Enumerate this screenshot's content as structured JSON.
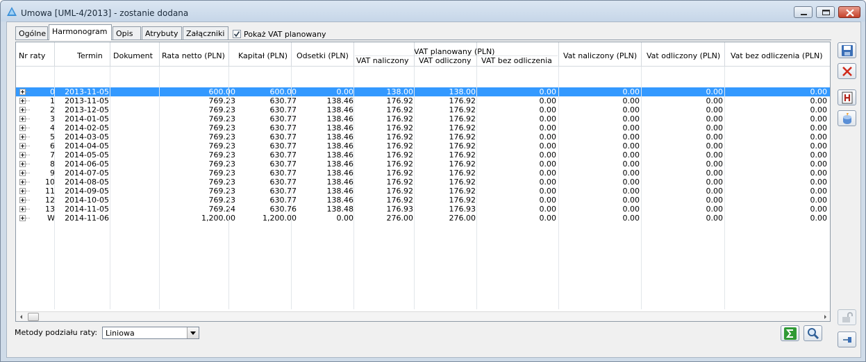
{
  "window": {
    "title": "Umowa [UML-4/2013] - zostanie dodana"
  },
  "tabs": [
    {
      "label": "Ogólne"
    },
    {
      "label": "Harmonogram",
      "active": true
    },
    {
      "label": "Opis"
    },
    {
      "label": "Atrybuty"
    },
    {
      "label": "Załączniki"
    }
  ],
  "show_vat_checkbox": {
    "label": "Pokaż VAT planowany",
    "checked": true
  },
  "table": {
    "headers": {
      "nr_raty": "Nr raty",
      "termin": "Termin",
      "dokument": "Dokument",
      "rata_netto": "Rata netto (PLN)",
      "kapital": "Kapitał (PLN)",
      "odsetki": "Odsetki (PLN)",
      "vat_planowany_group": "VAT planowany (PLN)",
      "vat_plan_naliczony": "VAT naliczony",
      "vat_plan_odliczony": "VAT odliczony",
      "vat_plan_bez": "VAT bez odliczenia",
      "vat_naliczony": "Vat naliczony (PLN)",
      "vat_odliczony": "Vat odliczony (PLN)",
      "vat_bez": "Vat bez odliczenia (PLN)"
    },
    "rows": [
      {
        "nr": "0",
        "termin": "2013-11-05",
        "dokument": "",
        "rata": "600.00",
        "kapital": "600.00",
        "odsetki": "0.00",
        "pn": "138.00",
        "po": "138.00",
        "pb": "0.00",
        "vn": "0.00",
        "vo": "0.00",
        "vb": "0.00"
      },
      {
        "nr": "1",
        "termin": "2013-11-05",
        "dokument": "",
        "rata": "769.23",
        "kapital": "630.77",
        "odsetki": "138.46",
        "pn": "176.92",
        "po": "176.92",
        "pb": "0.00",
        "vn": "0.00",
        "vo": "0.00",
        "vb": "0.00"
      },
      {
        "nr": "2",
        "termin": "2013-12-05",
        "dokument": "",
        "rata": "769.23",
        "kapital": "630.77",
        "odsetki": "138.46",
        "pn": "176.92",
        "po": "176.92",
        "pb": "0.00",
        "vn": "0.00",
        "vo": "0.00",
        "vb": "0.00"
      },
      {
        "nr": "3",
        "termin": "2014-01-05",
        "dokument": "",
        "rata": "769.23",
        "kapital": "630.77",
        "odsetki": "138.46",
        "pn": "176.92",
        "po": "176.92",
        "pb": "0.00",
        "vn": "0.00",
        "vo": "0.00",
        "vb": "0.00"
      },
      {
        "nr": "4",
        "termin": "2014-02-05",
        "dokument": "",
        "rata": "769.23",
        "kapital": "630.77",
        "odsetki": "138.46",
        "pn": "176.92",
        "po": "176.92",
        "pb": "0.00",
        "vn": "0.00",
        "vo": "0.00",
        "vb": "0.00"
      },
      {
        "nr": "5",
        "termin": "2014-03-05",
        "dokument": "",
        "rata": "769.23",
        "kapital": "630.77",
        "odsetki": "138.46",
        "pn": "176.92",
        "po": "176.92",
        "pb": "0.00",
        "vn": "0.00",
        "vo": "0.00",
        "vb": "0.00"
      },
      {
        "nr": "6",
        "termin": "2014-04-05",
        "dokument": "",
        "rata": "769.23",
        "kapital": "630.77",
        "odsetki": "138.46",
        "pn": "176.92",
        "po": "176.92",
        "pb": "0.00",
        "vn": "0.00",
        "vo": "0.00",
        "vb": "0.00"
      },
      {
        "nr": "7",
        "termin": "2014-05-05",
        "dokument": "",
        "rata": "769.23",
        "kapital": "630.77",
        "odsetki": "138.46",
        "pn": "176.92",
        "po": "176.92",
        "pb": "0.00",
        "vn": "0.00",
        "vo": "0.00",
        "vb": "0.00"
      },
      {
        "nr": "8",
        "termin": "2014-06-05",
        "dokument": "",
        "rata": "769.23",
        "kapital": "630.77",
        "odsetki": "138.46",
        "pn": "176.92",
        "po": "176.92",
        "pb": "0.00",
        "vn": "0.00",
        "vo": "0.00",
        "vb": "0.00"
      },
      {
        "nr": "9",
        "termin": "2014-07-05",
        "dokument": "",
        "rata": "769.23",
        "kapital": "630.77",
        "odsetki": "138.46",
        "pn": "176.92",
        "po": "176.92",
        "pb": "0.00",
        "vn": "0.00",
        "vo": "0.00",
        "vb": "0.00"
      },
      {
        "nr": "10",
        "termin": "2014-08-05",
        "dokument": "",
        "rata": "769.23",
        "kapital": "630.77",
        "odsetki": "138.46",
        "pn": "176.92",
        "po": "176.92",
        "pb": "0.00",
        "vn": "0.00",
        "vo": "0.00",
        "vb": "0.00"
      },
      {
        "nr": "11",
        "termin": "2014-09-05",
        "dokument": "",
        "rata": "769.23",
        "kapital": "630.77",
        "odsetki": "138.46",
        "pn": "176.92",
        "po": "176.92",
        "pb": "0.00",
        "vn": "0.00",
        "vo": "0.00",
        "vb": "0.00"
      },
      {
        "nr": "12",
        "termin": "2014-10-05",
        "dokument": "",
        "rata": "769.23",
        "kapital": "630.77",
        "odsetki": "138.46",
        "pn": "176.92",
        "po": "176.92",
        "pb": "0.00",
        "vn": "0.00",
        "vo": "0.00",
        "vb": "0.00"
      },
      {
        "nr": "13",
        "termin": "2014-11-05",
        "dokument": "",
        "rata": "769.24",
        "kapital": "630.76",
        "odsetki": "138.48",
        "pn": "176.93",
        "po": "176.93",
        "pb": "0.00",
        "vn": "0.00",
        "vo": "0.00",
        "vb": "0.00"
      },
      {
        "nr": "W",
        "termin": "2014-11-06",
        "dokument": "",
        "rata": "1,200.00",
        "kapital": "1,200.00",
        "odsetki": "0.00",
        "pn": "276.00",
        "po": "276.00",
        "pb": "0.00",
        "vn": "0.00",
        "vo": "0.00",
        "vb": "0.00"
      }
    ],
    "selected_row_index": 0
  },
  "metody": {
    "label": "Metody podziału raty:",
    "value": "Liniowa"
  },
  "toolbar_icons": [
    "save-icon",
    "delete-icon",
    "h-icon",
    "calculate-icon",
    "unlock-icon",
    "pin-icon"
  ],
  "bottom_icons": [
    "sum-icon",
    "search-icon"
  ],
  "colors": {
    "selection": "#3399ff",
    "titlebar": "#c6d6e8",
    "close_button": "#c4412a"
  }
}
